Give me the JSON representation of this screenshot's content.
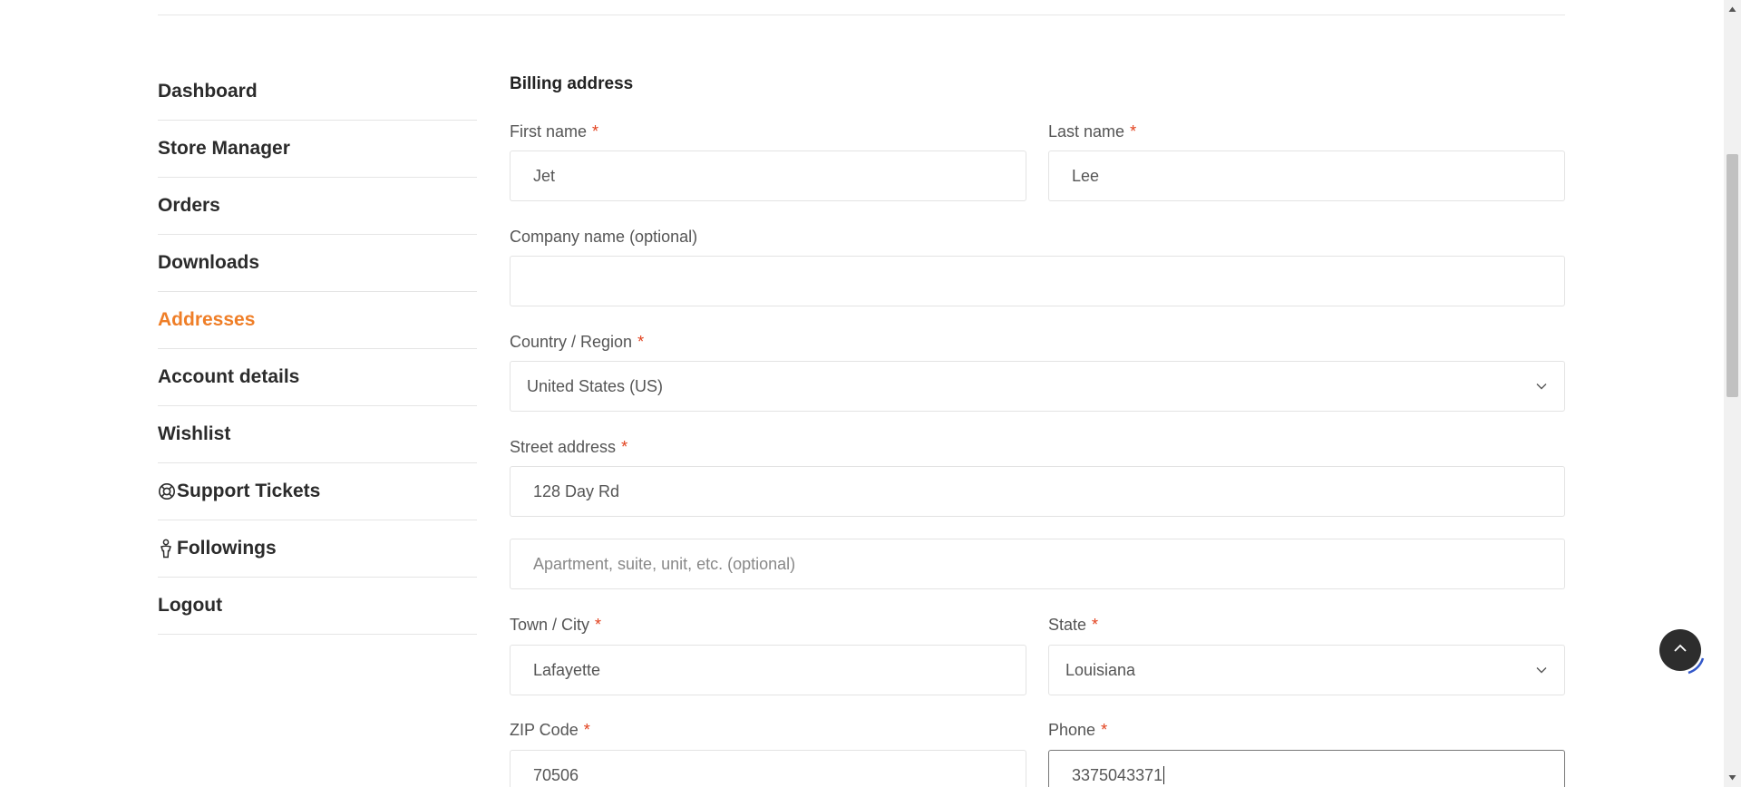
{
  "sidebar": {
    "items": [
      {
        "label": "Dashboard"
      },
      {
        "label": "Store Manager"
      },
      {
        "label": "Orders"
      },
      {
        "label": "Downloads"
      },
      {
        "label": "Addresses",
        "active": true
      },
      {
        "label": "Account details"
      },
      {
        "label": "Wishlist"
      },
      {
        "label": "Support Tickets",
        "icon": "lifebuoy-icon"
      },
      {
        "label": "Followings",
        "icon": "person-icon"
      },
      {
        "label": "Logout"
      }
    ]
  },
  "form": {
    "title": "Billing address",
    "required_marker": "*",
    "first_name": {
      "label": "First name",
      "value": "Jet"
    },
    "last_name": {
      "label": "Last name",
      "value": "Lee"
    },
    "company": {
      "label": "Company name (optional)",
      "value": ""
    },
    "country": {
      "label": "Country / Region",
      "value": "United States (US)"
    },
    "street": {
      "label": "Street address",
      "value": "128 Day Rd",
      "apt_placeholder": "Apartment, suite, unit, etc. (optional)"
    },
    "city": {
      "label": "Town / City",
      "value": "Lafayette"
    },
    "state": {
      "label": "State",
      "value": "Louisiana"
    },
    "zip": {
      "label": "ZIP Code",
      "value": "70506"
    },
    "phone": {
      "label": "Phone",
      "value": "3375043371"
    }
  },
  "colors": {
    "accent": "#ef7e27",
    "required": "#e2401c",
    "back_to_top": "#2d2d2d"
  },
  "icons": {
    "select": "chevron-down-icon",
    "back_to_top": "chevron-up-icon"
  }
}
